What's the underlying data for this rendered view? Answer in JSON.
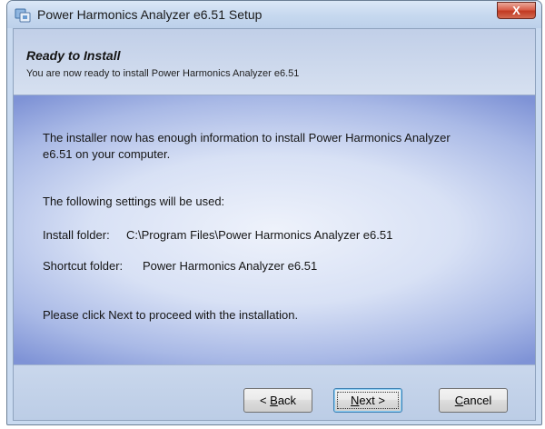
{
  "window": {
    "title": "Power  Harmonics Analyzer e6.51 Setup",
    "close_label": "X"
  },
  "header": {
    "title": "Ready to Install",
    "subtitle": "You are now ready to install Power  Harmonics Analyzer e6.51"
  },
  "body": {
    "line1": "The installer now has enough information to install Power  Harmonics Analyzer",
    "line2": "e6.51 on your computer.",
    "settings_intro": "The following settings will be used:",
    "install_folder_label": "Install folder:",
    "install_folder_value": "C:\\Program Files\\Power  Harmonics Analyzer e6.51",
    "shortcut_folder_label": "Shortcut folder:",
    "shortcut_folder_value": "Power  Harmonics Analyzer e6.51",
    "proceed_text": "Please click Next to proceed with the installation."
  },
  "buttons": {
    "back": {
      "prefix": "< ",
      "mnemonic": "B",
      "rest": "ack"
    },
    "next": {
      "mnemonic": "N",
      "rest": "ext >"
    },
    "cancel": {
      "mnemonic": "C",
      "rest": "ancel"
    }
  },
  "icons": {
    "app": "installer-app-icon",
    "close": "close-icon"
  },
  "colors": {
    "title_bar": "#c7d9ef",
    "close_button": "#c94a33",
    "body_gradient_edge": "#7f93d6",
    "body_gradient_center": "#eef2fb",
    "default_button_border": "#3c7fb1"
  }
}
